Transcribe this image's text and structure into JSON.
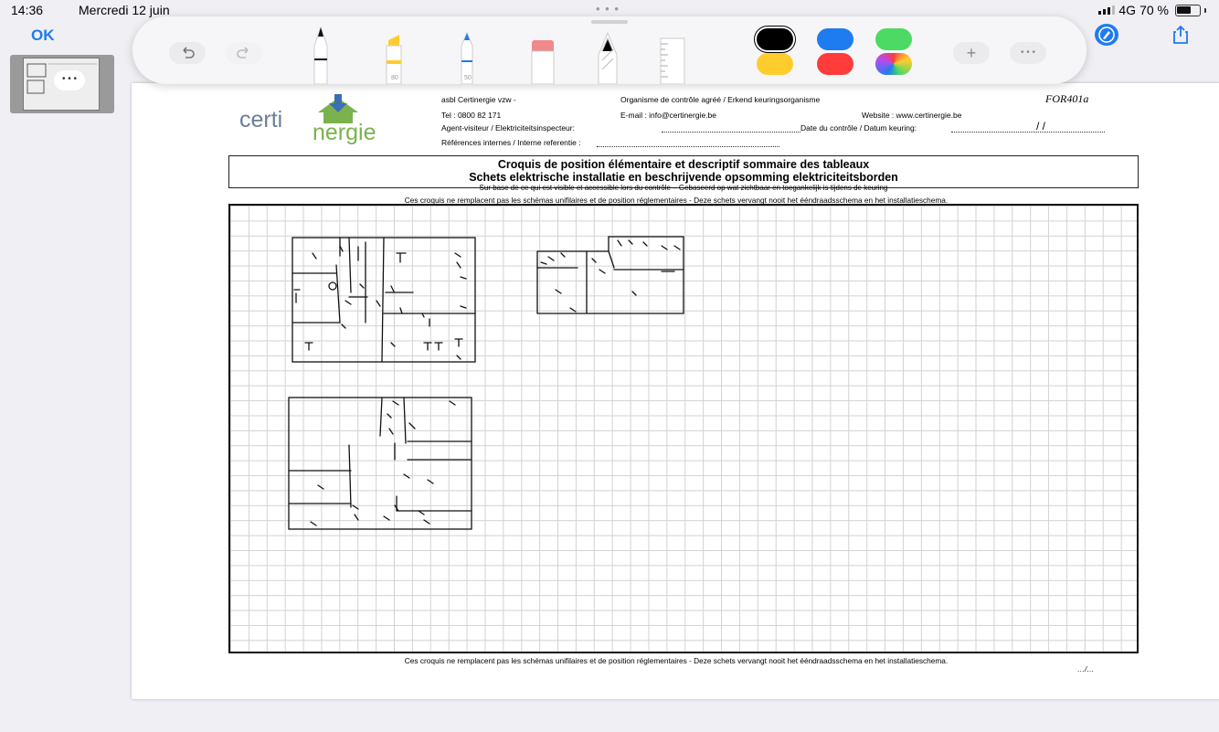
{
  "status_bar": {
    "time": "14:36",
    "date": "Mercredi 12 juin",
    "more": "• • •",
    "signal": "4G",
    "battery": "70 %"
  },
  "nav": {
    "ok_label": "OK"
  },
  "thumbnail": {
    "more": "• • •"
  },
  "toolbar": {
    "undo_icon": "undo-icon",
    "redo_icon": "redo-icon",
    "marker_size": "80",
    "pencil_size": "50",
    "add_label": "+",
    "more_label": "• • •",
    "colors": [
      "#000000",
      "#1f7bf0",
      "#4cd964",
      "#ffcc2e",
      "#ff3b3b",
      "color-wheel"
    ]
  },
  "document": {
    "org": "asbl Certinergie vzw   -",
    "org_type": "Organisme de contrôle agréé /  Erkend keuringsorganisme",
    "code": "FOR401a",
    "tel": "Tel : 0800 82 171",
    "email": "E-mail : info@certinergie.be",
    "website": "Website : www.certinergie.be",
    "agent_label": "Agent-visiteur / Elektriciteitsinspecteur:",
    "date_label": "Date du contrôle / Datum keuring:",
    "date_slashes": "/          /",
    "refs_label": "Références internes / Interne referentie :",
    "logo_certi": "certi",
    "logo_nergie": "nergie",
    "title_line1": "Croquis de position élémentaire et descriptif sommaire des tableaux",
    "title_line2": "Schets elektrische installatie en beschrijvende opsomming elektriciteitsborden",
    "title_line3": "Sur base de ce qui est visible et accessible lors du contrôle – Gebaseerd op wat zichtbaar en toegankelijk is tijdens de keuring",
    "disclaimer": "Ces croquis ne remplacent pas les schémas unifilaires et de position réglementaires - Deze schets vervangt nooit het ééndraadsschema en het installatieschema.",
    "page_num": "…/…"
  }
}
